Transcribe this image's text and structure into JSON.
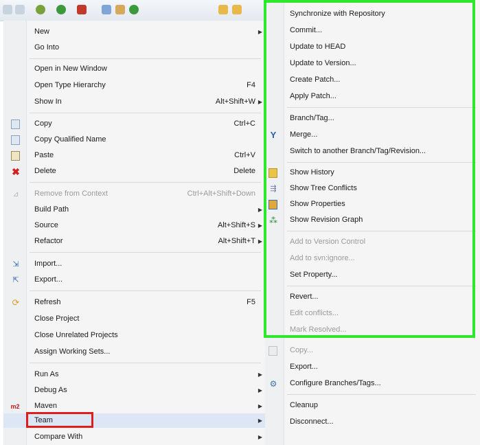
{
  "left_menu": {
    "new": "New",
    "go_into": "Go Into",
    "open_new_window": "Open in New Window",
    "open_type_hierarchy": "Open Type Hierarchy",
    "open_type_hierarchy_shortcut": "F4",
    "show_in": "Show In",
    "show_in_shortcut": "Alt+Shift+W",
    "copy": "Copy",
    "copy_shortcut": "Ctrl+C",
    "copy_qualified": "Copy Qualified Name",
    "paste": "Paste",
    "paste_shortcut": "Ctrl+V",
    "delete": "Delete",
    "delete_shortcut": "Delete",
    "remove_context": "Remove from Context",
    "remove_context_shortcut": "Ctrl+Alt+Shift+Down",
    "build_path": "Build Path",
    "source": "Source",
    "source_shortcut": "Alt+Shift+S",
    "refactor": "Refactor",
    "refactor_shortcut": "Alt+Shift+T",
    "import": "Import...",
    "export": "Export...",
    "refresh": "Refresh",
    "refresh_shortcut": "F5",
    "close_project": "Close Project",
    "close_unrelated": "Close Unrelated Projects",
    "assign_working_sets": "Assign Working Sets...",
    "run_as": "Run As",
    "debug_as": "Debug As",
    "maven": "Maven",
    "maven_badge": "m2",
    "team": "Team",
    "compare_with": "Compare With"
  },
  "team_menu": {
    "synchronize": "Synchronize with Repository",
    "commit": "Commit...",
    "update_head": "Update to HEAD",
    "update_version": "Update to Version...",
    "create_patch": "Create Patch...",
    "apply_patch": "Apply Patch...",
    "branch_tag": "Branch/Tag...",
    "merge": "Merge...",
    "switch": "Switch to another Branch/Tag/Revision...",
    "show_history": "Show History",
    "show_tree_conflicts": "Show Tree Conflicts",
    "show_properties": "Show Properties",
    "show_revision_graph": "Show Revision Graph",
    "add_version_control": "Add to Version Control",
    "add_svnignore": "Add to svn:ignore...",
    "set_property": "Set Property...",
    "revert": "Revert...",
    "edit_conflicts": "Edit conflicts...",
    "mark_resolved": "Mark Resolved...",
    "copy": "Copy...",
    "export": "Export...",
    "configure_branches": "Configure Branches/Tags...",
    "cleanup": "Cleanup",
    "disconnect": "Disconnect..."
  },
  "colors": {
    "highlight_green": "#2ee82e",
    "highlight_red": "#e01d1d"
  }
}
